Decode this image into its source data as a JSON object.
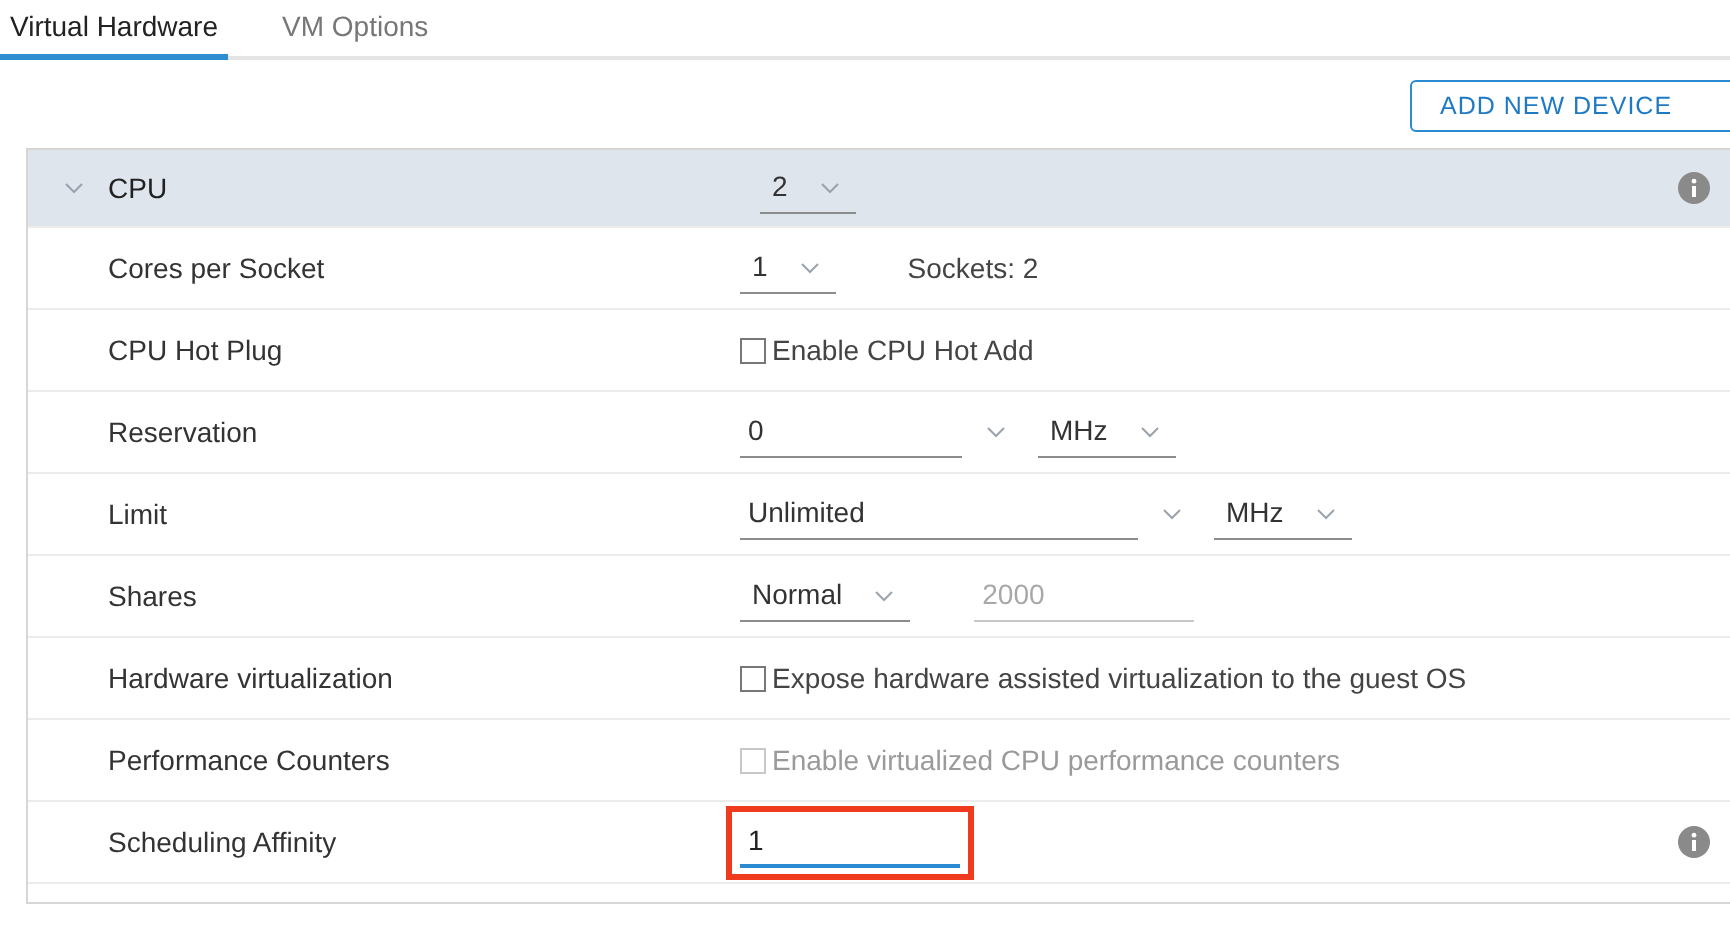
{
  "tabs": [
    {
      "label": "Virtual Hardware",
      "selected": true
    },
    {
      "label": "VM Options",
      "selected": false
    }
  ],
  "add_button": "ADD NEW DEVICE",
  "section": {
    "title": "CPU",
    "expanded": true,
    "info": true,
    "controls": [
      {
        "kind": "select",
        "value": "2"
      }
    ]
  },
  "rows": [
    {
      "label": "Cores per Socket",
      "info": false,
      "controls": [
        {
          "kind": "select",
          "value": "1"
        },
        {
          "kind": "text",
          "value": "Sockets: 2"
        }
      ]
    },
    {
      "label": "CPU Hot Plug",
      "info": false,
      "controls": [
        {
          "kind": "checkbox",
          "value": "Enable CPU Hot Add",
          "checked": false,
          "disabled": false
        }
      ]
    },
    {
      "label": "Reservation",
      "info": false,
      "controls": [
        {
          "kind": "combo",
          "value": "0"
        },
        {
          "kind": "select",
          "value": "MHz"
        }
      ]
    },
    {
      "label": "Limit",
      "info": false,
      "controls": [
        {
          "kind": "combo",
          "value": "Unlimited"
        },
        {
          "kind": "select",
          "value": "MHz"
        }
      ]
    },
    {
      "label": "Shares",
      "info": false,
      "controls": [
        {
          "kind": "select",
          "value": "Normal"
        },
        {
          "kind": "input",
          "value": "2000",
          "disabled": true,
          "focused": false,
          "highlighted": false
        }
      ]
    },
    {
      "label": "Hardware virtualization",
      "info": false,
      "controls": [
        {
          "kind": "checkbox",
          "value": "Expose hardware assisted virtualization to the guest OS",
          "checked": false,
          "disabled": false
        }
      ]
    },
    {
      "label": "Performance Counters",
      "info": false,
      "controls": [
        {
          "kind": "checkbox",
          "value": "Enable virtualized CPU performance counters",
          "checked": false,
          "disabled": true
        }
      ]
    },
    {
      "label": "Scheduling Affinity",
      "info": true,
      "controls": [
        {
          "kind": "input",
          "value": "1",
          "disabled": false,
          "focused": true,
          "highlighted": true
        }
      ]
    }
  ]
}
